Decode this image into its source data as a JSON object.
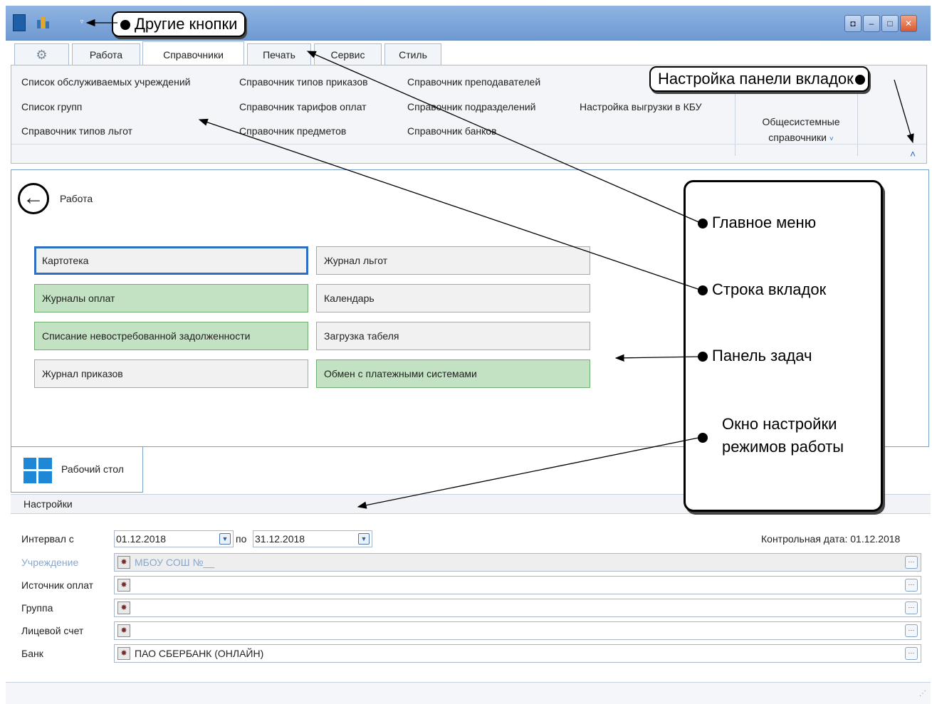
{
  "callouts": {
    "other_buttons": "Другие кнопки",
    "tabs_panel_setup": "Настройка панели вкладок",
    "main_menu": "Главное меню",
    "tab_row": "Строка вкладок",
    "task_panel": "Панель задач",
    "mode_window_line1": "Окно настройки",
    "mode_window_line2": "режимов работы"
  },
  "tabs": [
    {
      "label": ""
    },
    {
      "label": "Работа"
    },
    {
      "label": "Справочники"
    },
    {
      "label": "Печать"
    },
    {
      "label": "Сервис"
    },
    {
      "label": "Стиль"
    }
  ],
  "ribbon": {
    "col1": [
      "Список обслуживаемых учреждений",
      "Список групп",
      "Справочник типов льгот"
    ],
    "col2": [
      "Справочник типов приказов",
      "Справочник тарифов оплат",
      "Справочник предметов"
    ],
    "col3": [
      "Справочник преподавателей",
      "Справочник подразделений",
      "Справочник банков"
    ],
    "col4": [
      "Настройка выгрузки в КБУ"
    ],
    "group_line1": "Общесистемные",
    "group_line2": "справочники"
  },
  "main": {
    "back_label": "Работа",
    "tasks_left": [
      {
        "label": "Картотека",
        "style": "focused"
      },
      {
        "label": "Журналы оплат",
        "style": "green"
      },
      {
        "label": "Списание невостребованной задолженности",
        "style": "green"
      },
      {
        "label": "Журнал приказов",
        "style": "plain"
      }
    ],
    "tasks_right": [
      {
        "label": "Журнал льгот",
        "style": "plain"
      },
      {
        "label": "Календарь",
        "style": "plain"
      },
      {
        "label": "Загрузка табеля",
        "style": "plain"
      },
      {
        "label": "Обмен с платежными системами",
        "style": "green"
      }
    ]
  },
  "desktop_tab": "Рабочий стол",
  "settings": {
    "title": "Настройки",
    "interval_label": "Интервал с",
    "date_from": "01.12.2018",
    "to_label": "по",
    "date_to": "31.12.2018",
    "control_date": "Контрольная дата: 01.12.2018",
    "rows": [
      {
        "label": "Учреждение",
        "value": "МБОУ СОШ №__",
        "disabled": true
      },
      {
        "label": "Источник оплат",
        "value": "",
        "disabled": false
      },
      {
        "label": "Группа",
        "value": "",
        "disabled": false
      },
      {
        "label": "Лицевой счет",
        "value": "",
        "disabled": false
      },
      {
        "label": "Банк",
        "value": "ПАО СБЕРБАНК (ОНЛАЙН)",
        "disabled": false
      }
    ]
  },
  "colors": {
    "accent": "#2f6fbf",
    "task_green": "#c3e2c3",
    "titlebar": "#7fa6da"
  }
}
